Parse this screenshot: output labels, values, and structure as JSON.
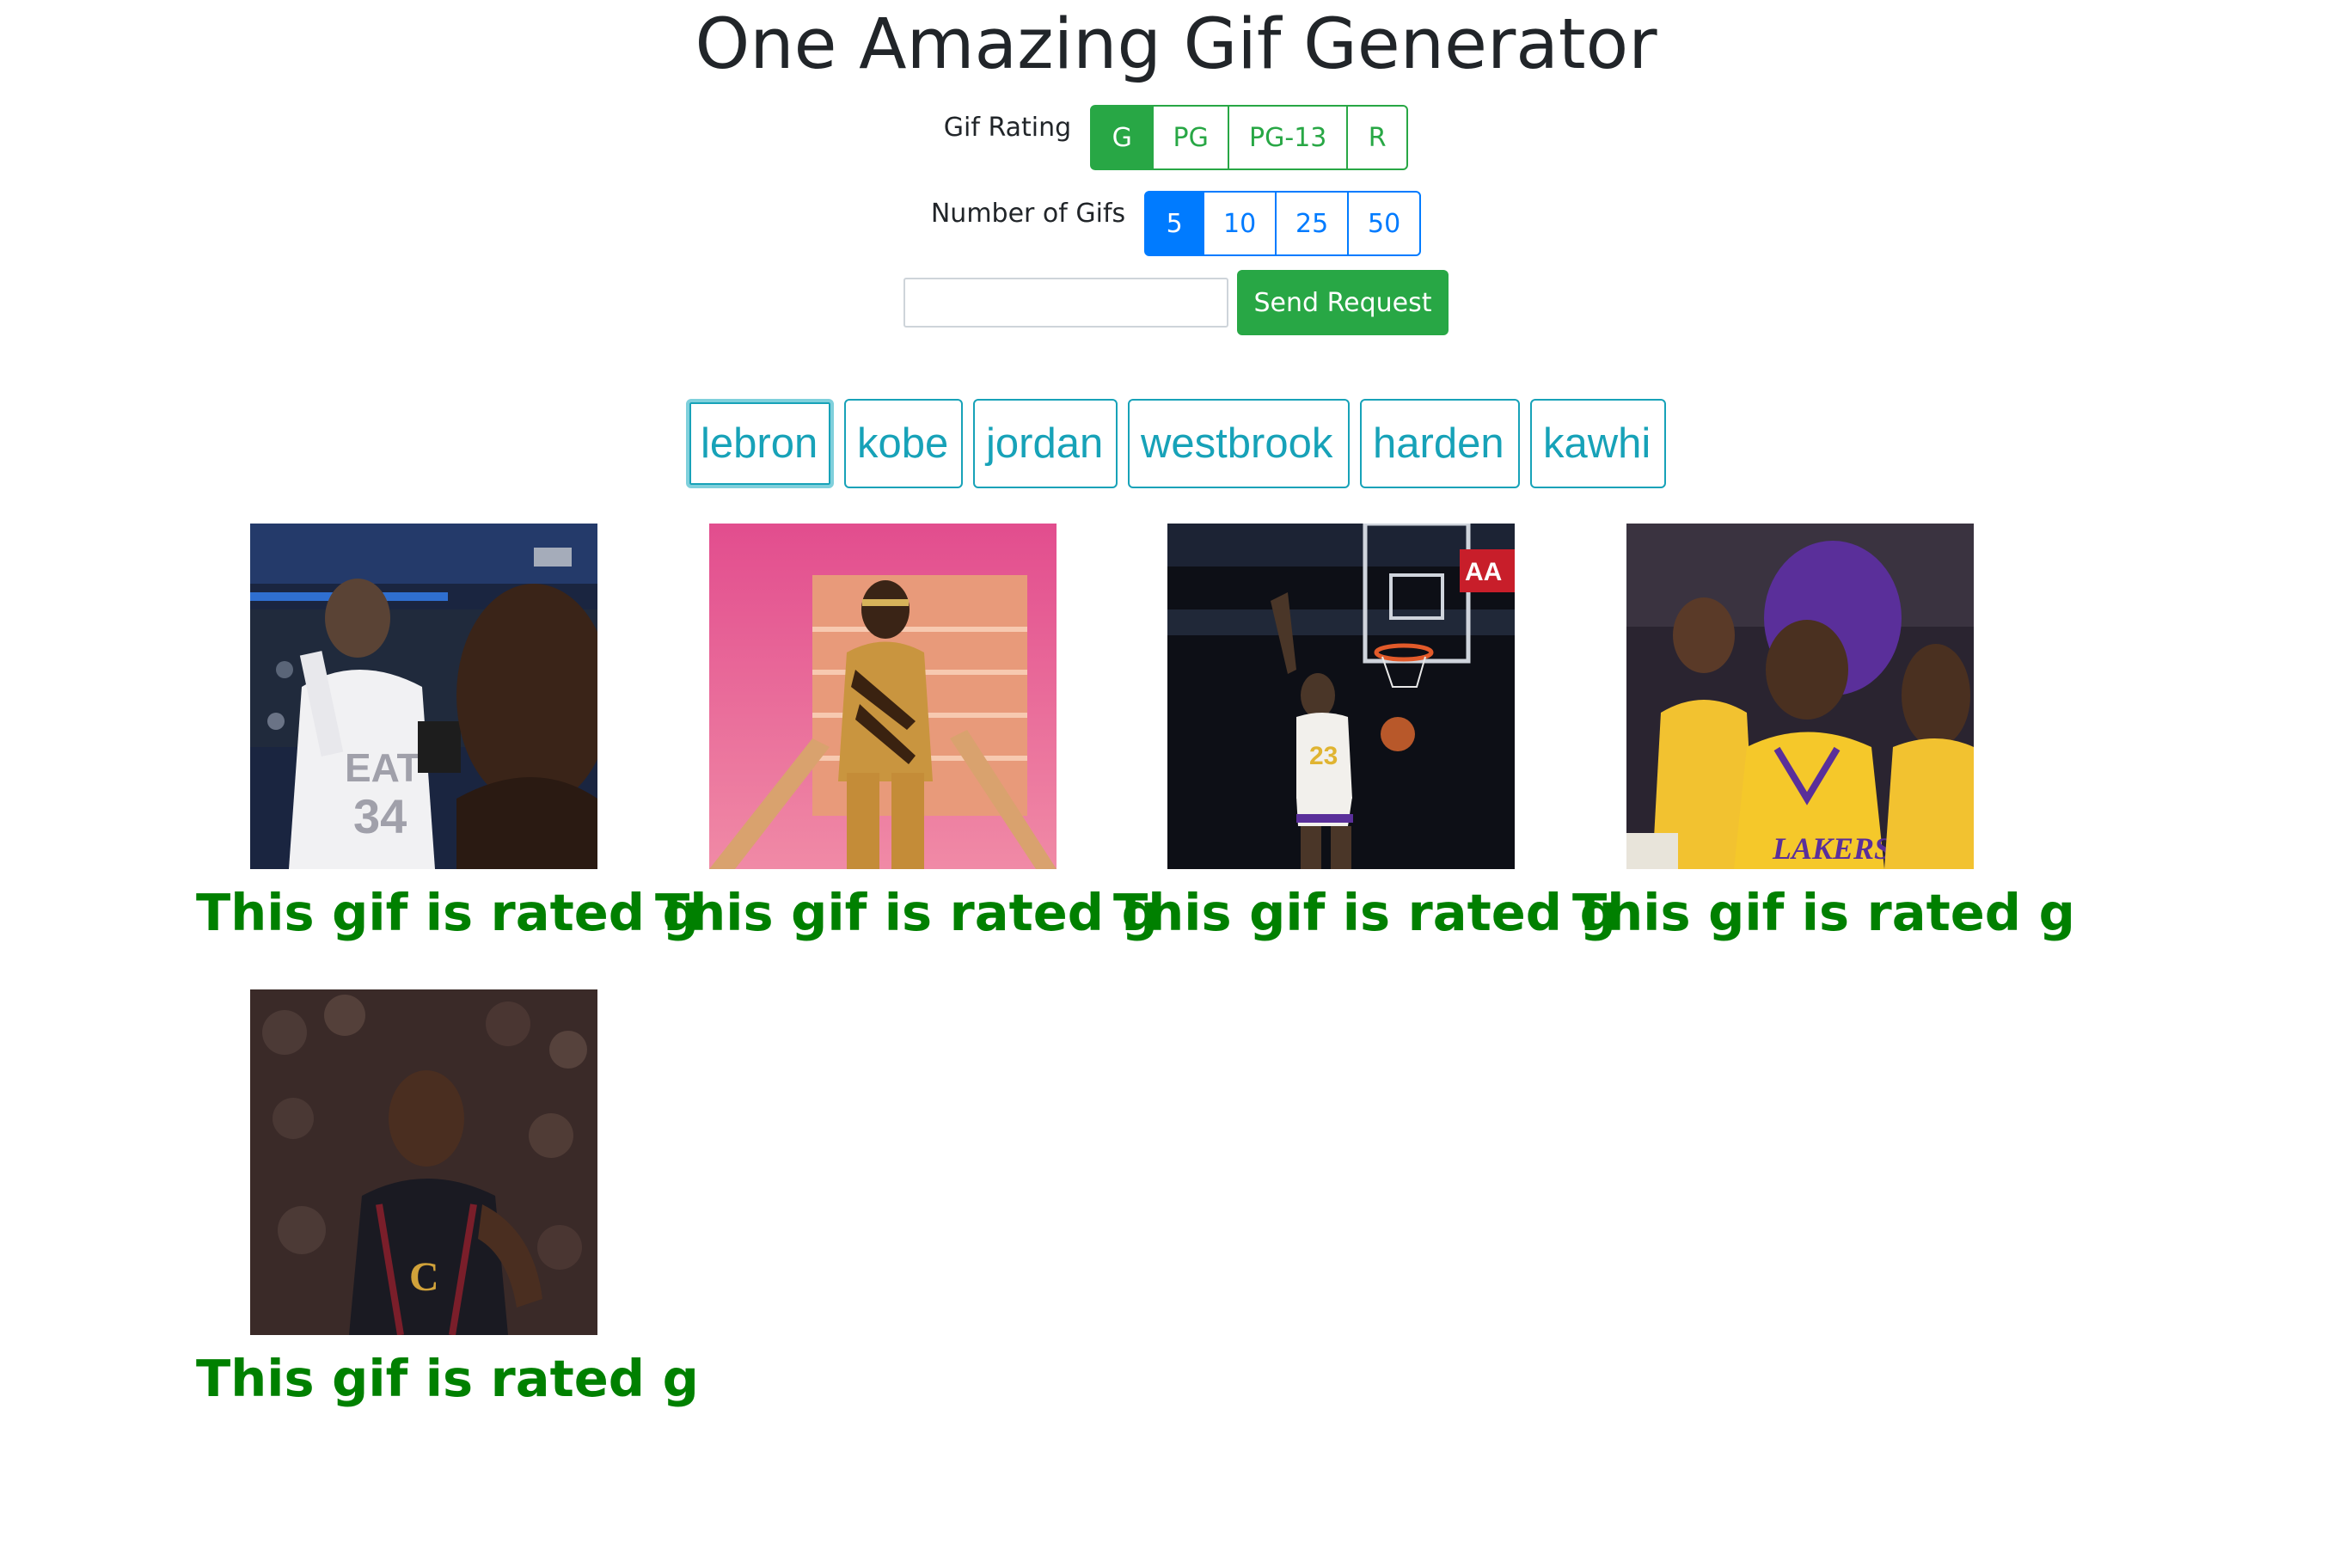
{
  "page": {
    "title": "One Amazing Gif Generator"
  },
  "rating": {
    "label": "Gif Rating",
    "options": [
      "G",
      "PG",
      "PG-13",
      "R"
    ],
    "selected": "G"
  },
  "count": {
    "label": "Number of Gifs",
    "options": [
      "5",
      "10",
      "25",
      "50"
    ],
    "selected": "5"
  },
  "search": {
    "value": "",
    "placeholder": "",
    "button_label": "Send Request"
  },
  "tags": [
    "lebron",
    "kobe",
    "jordan",
    "westbrook",
    "harden",
    "kawhi"
  ],
  "focused_tag": "lebron",
  "gifs": [
    {
      "caption": "This gif is rated g"
    },
    {
      "caption": "This gif is rated g"
    },
    {
      "caption": "This gif is rated g"
    },
    {
      "caption": "This gif is rated g"
    },
    {
      "caption": "This gif is rated g"
    }
  ],
  "colors": {
    "success": "#28a745",
    "primary": "#007bff",
    "info": "#17a2b8",
    "caption": "#008000"
  }
}
